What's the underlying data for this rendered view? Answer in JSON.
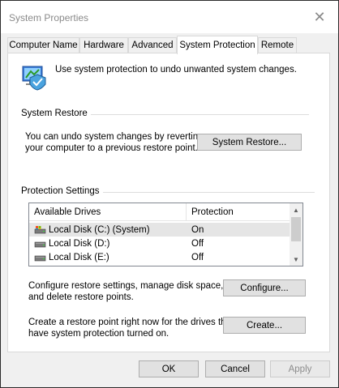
{
  "window": {
    "title": "System Properties",
    "close_symbol": "✕"
  },
  "tabs": [
    {
      "label": "Computer Name",
      "active": false
    },
    {
      "label": "Hardware",
      "active": false
    },
    {
      "label": "Advanced",
      "active": false
    },
    {
      "label": "System Protection",
      "active": true
    },
    {
      "label": "Remote",
      "active": false
    }
  ],
  "intro": {
    "icon": "system-protection-icon",
    "text": "Use system protection to undo unwanted system changes."
  },
  "system_restore": {
    "group_label": "System Restore",
    "description_line1": "You can undo system changes by reverting",
    "description_line2": "your computer to a previous restore point.",
    "button_label": "System Restore..."
  },
  "protection_settings": {
    "group_label": "Protection Settings",
    "columns": [
      "Available Drives",
      "Protection"
    ],
    "drives": [
      {
        "name": "Local Disk (C:) (System)",
        "protection": "On",
        "icon": "system-drive-icon",
        "selected": true
      },
      {
        "name": "Local Disk (D:)",
        "protection": "Off",
        "icon": "drive-icon",
        "selected": false
      },
      {
        "name": "Local Disk (E:)",
        "protection": "Off",
        "icon": "drive-icon",
        "selected": false
      }
    ],
    "configure_line1": "Configure restore settings, manage disk space,",
    "configure_line2": "and delete restore points.",
    "configure_button": "Configure...",
    "create_line1": "Create a restore point right now for the drives that",
    "create_line2": "have system protection turned on.",
    "create_button": "Create..."
  },
  "footer": {
    "ok": "OK",
    "cancel": "Cancel",
    "apply": "Apply"
  },
  "colors": {
    "window_bg": "#f0f0f0",
    "panel_bg": "#ffffff",
    "button_bg": "#e1e1e1",
    "selected_row": "#e5e5e5",
    "disabled_text": "#8c8c8c"
  }
}
